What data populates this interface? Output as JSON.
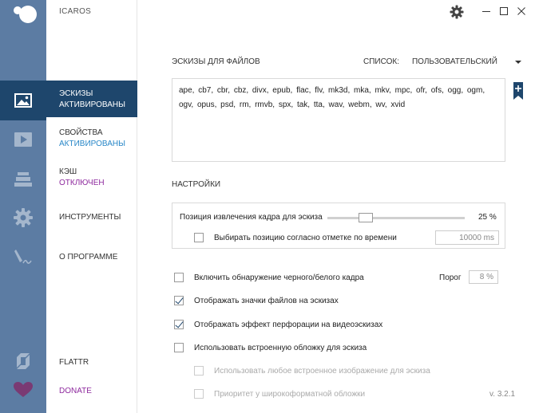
{
  "app": {
    "title": "ICAROS"
  },
  "nav": {
    "items": [
      {
        "id": "thumbnails",
        "label": "ЭСКИЗЫ",
        "status": "АКТИВИРОВАНЫ"
      },
      {
        "id": "properties",
        "label": "СВОЙСТВА",
        "status": "АКТИВИРОВАНЫ"
      },
      {
        "id": "cache",
        "label": "КЭШ",
        "status": "ОТКЛЮЧЕН"
      },
      {
        "id": "tools",
        "label": "ИНСТРУМЕНТЫ",
        "status": ""
      },
      {
        "id": "about",
        "label": "О ПРОГРАММЕ",
        "status": ""
      }
    ],
    "flattr": "FLATTR",
    "donate": "DONATE"
  },
  "thumbnails": {
    "section_title": "ЭСКИЗЫ ДЛЯ ФАЙЛОВ",
    "list_label": "СПИСОК:",
    "list_value": "ПОЛЬЗОВАТЕЛЬСКИЙ",
    "extensions": "ape, cb7, cbr, cbz, divx, epub, flac, flv, mk3d, mka, mkv, mpc, ofr, ofs, ogg, ogm, ogv, opus, psd, rm, rmvb, spx, tak, tta, wav, webm, wv, xvid"
  },
  "settings": {
    "section_title": "НАСТРОЙКИ",
    "frame_position_label": "Позиция извлечения кадра для эскиза",
    "frame_position_value": "25 %",
    "frame_position_fraction": 0.25,
    "timestamp_label": "Выбирать позицию согласно отметке по времени",
    "timestamp_value": "10000 ms",
    "timestamp_checked": false,
    "bw_detect_label": "Включить обнаружение черного/белого кадра",
    "bw_detect_checked": false,
    "threshold_label": "Порог",
    "threshold_value": "8 %",
    "show_icons_label": "Отображать значки файлов на эскизах",
    "show_icons_checked": true,
    "perforation_label": "Отображать эффект перфорации на видеоэскизах",
    "perforation_checked": true,
    "embedded_cover_label": "Использовать встроенную обложку для эскиза",
    "embedded_cover_checked": false,
    "any_embedded_label": "Использовать любое встроенное изображение для эскиза",
    "widescreen_label": "Приоритет у широкоформатной обложки"
  },
  "version": "v. 3.2.1",
  "colors": {
    "sidebar": "#5c7ca3",
    "active": "#1e466c",
    "properties_status": "#2a88c8",
    "cache_status": "#8e2a9e",
    "donate": "#8e2a9e"
  }
}
